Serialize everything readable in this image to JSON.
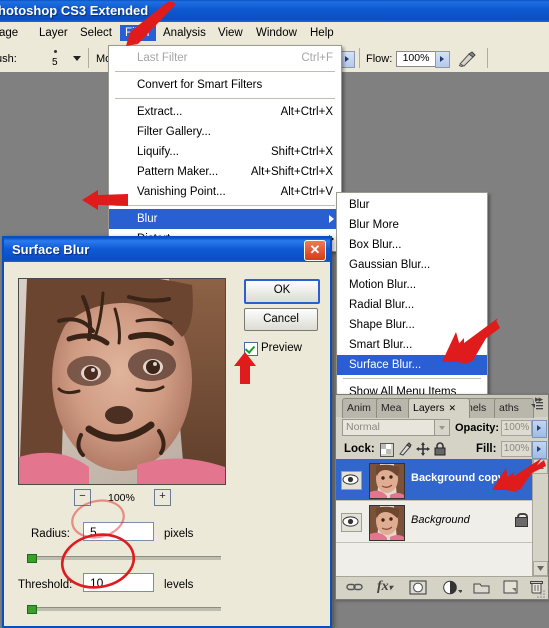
{
  "window": {
    "title": "hotoshop CS3 Extended"
  },
  "menubar": {
    "items": [
      {
        "label": "age",
        "selected": false
      },
      {
        "label": "Layer",
        "selected": false
      },
      {
        "label": "Select",
        "selected": false
      },
      {
        "label": "Filter",
        "selected": true
      },
      {
        "label": "Analysis",
        "selected": false
      },
      {
        "label": "View",
        "selected": false
      },
      {
        "label": "Window",
        "selected": false
      },
      {
        "label": "Help",
        "selected": false
      }
    ]
  },
  "options_bar": {
    "brush_label": "ush:",
    "brush_value": "5",
    "mode_label": "Mode:",
    "flow_label": "Flow:",
    "flow_value": "100%",
    "airbrush_icon": "airbrush-icon"
  },
  "filter_menu": {
    "items": [
      {
        "label": "Last Filter",
        "shortcut": "Ctrl+F",
        "disabled": true,
        "submenu": false,
        "highlighted": false
      },
      {
        "separator": true
      },
      {
        "label": "Convert for Smart Filters",
        "shortcut": "",
        "disabled": false,
        "submenu": false,
        "highlighted": false
      },
      {
        "separator": true
      },
      {
        "label": "Extract...",
        "shortcut": "Alt+Ctrl+X",
        "disabled": false,
        "submenu": false,
        "highlighted": false
      },
      {
        "label": "Filter Gallery...",
        "shortcut": "",
        "disabled": false,
        "submenu": false,
        "highlighted": false
      },
      {
        "label": "Liquify...",
        "shortcut": "Shift+Ctrl+X",
        "disabled": false,
        "submenu": false,
        "highlighted": false
      },
      {
        "label": "Pattern Maker...",
        "shortcut": "Alt+Shift+Ctrl+X",
        "disabled": false,
        "submenu": false,
        "highlighted": false
      },
      {
        "label": "Vanishing Point...",
        "shortcut": "Alt+Ctrl+V",
        "disabled": false,
        "submenu": false,
        "highlighted": false
      },
      {
        "separator": true
      },
      {
        "label": "Blur",
        "shortcut": "",
        "disabled": false,
        "submenu": true,
        "highlighted": true
      },
      {
        "label": "Distort",
        "shortcut": "",
        "disabled": false,
        "submenu": true,
        "highlighted": false
      }
    ]
  },
  "blur_submenu": {
    "items": [
      {
        "label": "Blur",
        "highlighted": false
      },
      {
        "label": "Blur More",
        "highlighted": false
      },
      {
        "label": "Box Blur...",
        "highlighted": false
      },
      {
        "label": "Gaussian Blur...",
        "highlighted": false
      },
      {
        "label": "Motion Blur...",
        "highlighted": false
      },
      {
        "label": "Radial Blur...",
        "highlighted": false
      },
      {
        "label": "Shape Blur...",
        "highlighted": false
      },
      {
        "label": "Smart Blur...",
        "highlighted": false
      },
      {
        "label": "Surface Blur...",
        "highlighted": true
      },
      {
        "separator": true
      },
      {
        "label": "Show All Menu Items",
        "highlighted": false
      }
    ]
  },
  "dialog": {
    "title": "Surface Blur",
    "close_label": "✕",
    "ok_label": "OK",
    "cancel_label": "Cancel",
    "preview_label": "Preview",
    "preview_checked": true,
    "zoom_out_label": "−",
    "zoom_in_label": "+",
    "zoom_level": "100%",
    "radius_label": "Radius:",
    "radius_value": "5",
    "radius_units": "pixels",
    "threshold_label": "Threshold:",
    "threshold_value": "10",
    "threshold_units": "levels"
  },
  "layers_panel": {
    "tabs": [
      {
        "label": "Anim",
        "active": false
      },
      {
        "label": "Mea",
        "active": false
      },
      {
        "label": "Layers",
        "active": true,
        "close_glyph": "✕"
      },
      {
        "label": "nels",
        "active": false
      },
      {
        "label": "aths",
        "active": false
      }
    ],
    "panel_menu_icon": "panel-menu-icon",
    "blend_mode": "Normal",
    "opacity_label": "Opacity:",
    "opacity_value": "100%",
    "lock_label": "Lock:",
    "lock_icons": [
      "lock-transparent-icon",
      "lock-image-icon",
      "lock-position-icon",
      "lock-all-icon"
    ],
    "fill_label": "Fill:",
    "fill_value": "100%",
    "layers": [
      {
        "name": "Background copy",
        "selected": true,
        "visible": true,
        "locked": false
      },
      {
        "name": "Background",
        "selected": false,
        "visible": true,
        "locked": true
      }
    ],
    "footer_icons": [
      "link-layers-icon",
      "layer-style-fx-icon",
      "layer-mask-icon",
      "adjustment-layer-icon",
      "new-group-icon",
      "new-layer-icon",
      "delete-layer-icon"
    ]
  },
  "annotations": {
    "arrow_color": "#e01b1b",
    "arrows": [
      "arrow-to-filter-menu",
      "arrow-to-blur-item",
      "arrow-to-surface-blur",
      "arrow-to-preview-checkbox",
      "arrow-to-background-copy-layer"
    ],
    "ellipses": [
      "ellipse-around-radius-field",
      "ellipse-around-threshold-field"
    ]
  }
}
